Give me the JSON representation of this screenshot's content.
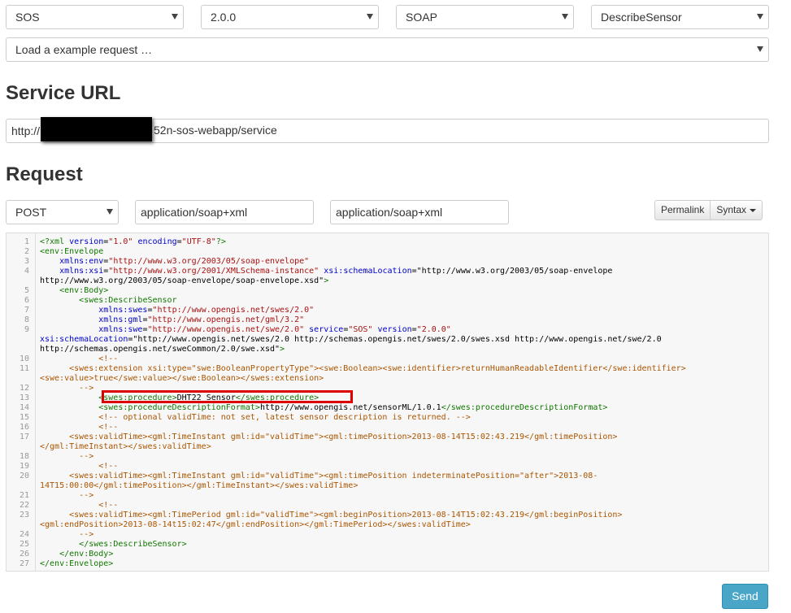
{
  "selects": {
    "service": "SOS",
    "version": "2.0.0",
    "binding": "SOAP",
    "operation": "DescribeSensor",
    "example": "Load a example request …"
  },
  "service_url": {
    "heading": "Service URL",
    "prefix": "http://",
    "rest": "52n-sos-webapp/service"
  },
  "request": {
    "heading": "Request",
    "method": "POST",
    "content_type": "application/soap+xml",
    "accept": "application/soap+xml",
    "permalink_label": "Permalink",
    "syntax_label": "Syntax"
  },
  "editor": {
    "lines": [
      {
        "n": "1",
        "t": "<?xml version=\"1.0\" encoding=\"UTF-8\"?>"
      },
      {
        "n": "2",
        "t": "<env:Envelope"
      },
      {
        "n": "3",
        "t": "    xmlns:env=\"http://www.w3.org/2003/05/soap-envelope\""
      },
      {
        "n": "4",
        "t": "    xmlns:xsi=\"http://www.w3.org/2001/XMLSchema-instance\" xsi:schemaLocation=\"http://www.w3.org/2003/05/soap-envelope"
      },
      {
        "n": "",
        "t": "http://www.w3.org/2003/05/soap-envelope/soap-envelope.xsd\">"
      },
      {
        "n": "5",
        "t": "    <env:Body>"
      },
      {
        "n": "6",
        "t": "        <swes:DescribeSensor"
      },
      {
        "n": "7",
        "t": "            xmlns:swes=\"http://www.opengis.net/swes/2.0\""
      },
      {
        "n": "8",
        "t": "            xmlns:gml=\"http://www.opengis.net/gml/3.2\""
      },
      {
        "n": "9",
        "t": "            xmlns:swe=\"http://www.opengis.net/swe/2.0\" service=\"SOS\" version=\"2.0.0\""
      },
      {
        "n": "",
        "t": "xsi:schemaLocation=\"http://www.opengis.net/swes/2.0 http://schemas.opengis.net/swes/2.0/swes.xsd http://www.opengis.net/swe/2.0"
      },
      {
        "n": "",
        "t": "http://schemas.opengis.net/sweCommon/2.0/swe.xsd\">"
      },
      {
        "n": "10",
        "t": "            <!--"
      },
      {
        "n": "11",
        "t": "      <swes:extension xsi:type=\"swe:BooleanPropertyType\"><swe:Boolean><swe:identifier>returnHumanReadableIdentifier</swe:identifier>"
      },
      {
        "n": "",
        "t": "<swe:value>true</swe:value></swe:Boolean></swes:extension>"
      },
      {
        "n": "12",
        "t": "        -->"
      },
      {
        "n": "13",
        "t": "            <swes:procedure>DHT22 Sensor</swes:procedure>"
      },
      {
        "n": "14",
        "t": "            <swes:procedureDescriptionFormat>http://www.opengis.net/sensorML/1.0.1</swes:procedureDescriptionFormat>"
      },
      {
        "n": "15",
        "t": "            <!-- optional validTime: not set, latest sensor description is returned. -->"
      },
      {
        "n": "16",
        "t": "            <!--"
      },
      {
        "n": "17",
        "t": "      <swes:validTime><gml:TimeInstant gml:id=\"validTime\"><gml:timePosition>2013-08-14T15:02:43.219</gml:timePosition>"
      },
      {
        "n": "",
        "t": "</gml:TimeInstant></swes:validTime>"
      },
      {
        "n": "18",
        "t": "        -->"
      },
      {
        "n": "19",
        "t": "            <!--"
      },
      {
        "n": "20",
        "t": "      <swes:validTime><gml:TimeInstant gml:id=\"validTime\"><gml:timePosition indeterminatePosition=\"after\">2013-08-"
      },
      {
        "n": "",
        "t": "14T15:00:00</gml:timePosition></gml:TimeInstant></swes:validTime>"
      },
      {
        "n": "21",
        "t": "        -->"
      },
      {
        "n": "22",
        "t": "            <!--"
      },
      {
        "n": "23",
        "t": "      <swes:validTime><gml:TimePeriod gml:id=\"validTime\"><gml:beginPosition>2013-08-14T15:02:43.219</gml:beginPosition>"
      },
      {
        "n": "",
        "t": "<gml:endPosition>2013-08-14t15:02:47</gml:endPosition></gml:TimePeriod></swes:validTime>"
      },
      {
        "n": "24",
        "t": "        -->"
      },
      {
        "n": "25",
        "t": "        </swes:DescribeSensor>"
      },
      {
        "n": "26",
        "t": "    </env:Body>"
      },
      {
        "n": "27",
        "t": "</env:Envelope>"
      }
    ]
  },
  "send_label": "Send",
  "colors": {
    "tag": "#117700",
    "attribute": "#0000cc",
    "string": "#aa1111",
    "comment": "#aa5500",
    "send_button": "#4aa6c7",
    "highlight": "#dd0000"
  }
}
